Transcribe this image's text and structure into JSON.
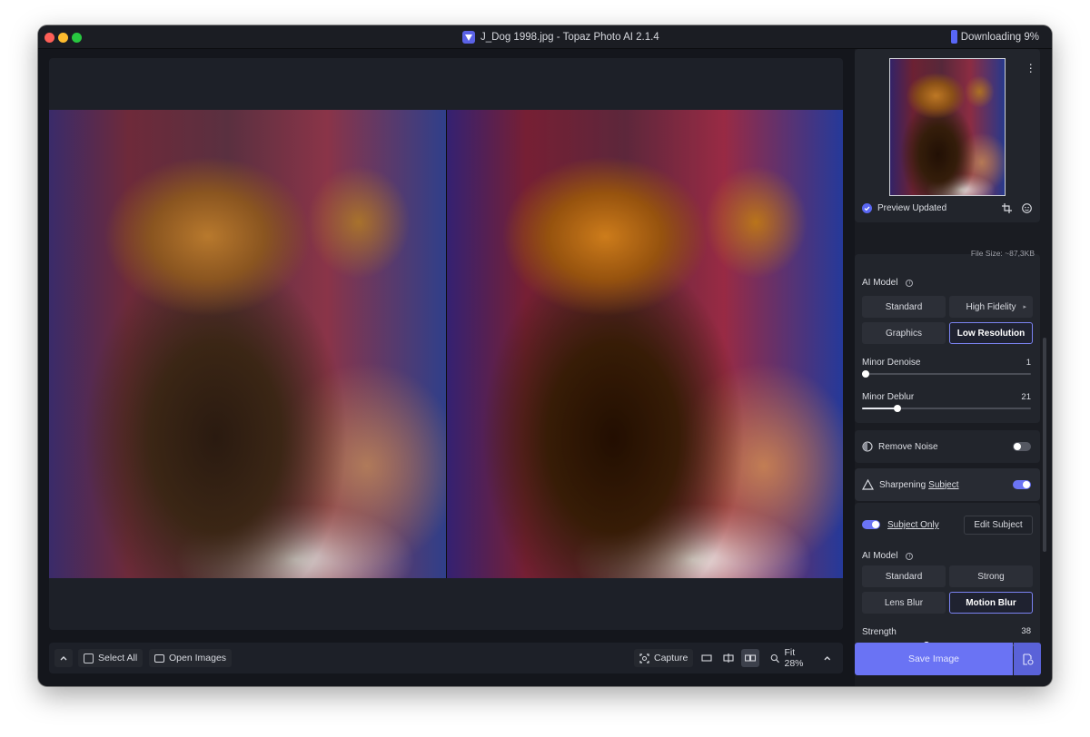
{
  "window": {
    "title": "J_Dog 1998.jpg - Topaz Photo AI 2.1.4",
    "download_status": "Downloading 9%"
  },
  "colors": {
    "accent": "#6a73f4",
    "toggle_on": "#6b74f5",
    "selected_border": "#7b83f2",
    "status_check": "#5a67f2"
  },
  "preview": {
    "status": "Preview Updated",
    "file_size": "File Size: ~87,3KB"
  },
  "enhance": {
    "ai_model_label": "AI Model",
    "models": [
      "Standard",
      "High Fidelity",
      "Graphics",
      "Low Resolution"
    ],
    "selected_model": "Low Resolution",
    "sliders": [
      {
        "label": "Minor Denoise",
        "value": "1",
        "fraction": 0.01
      },
      {
        "label": "Minor Deblur",
        "value": "21",
        "fraction": 0.21
      }
    ]
  },
  "remove_noise": {
    "label": "Remove Noise",
    "enabled": false
  },
  "sharpening": {
    "label": "Sharpening",
    "subject_link": "Subject",
    "enabled": true,
    "subject_only_label": "Subject Only",
    "subject_only_enabled": true,
    "edit_subject_label": "Edit Subject",
    "ai_model_label": "AI Model",
    "models": [
      "Standard",
      "Strong",
      "Lens Blur",
      "Motion Blur"
    ],
    "selected_model": "Motion Blur",
    "strength_label": "Strength",
    "strength_value": "38",
    "strength_fraction": 0.38
  },
  "bottombar": {
    "select_all": "Select All",
    "open_images": "Open Images",
    "capture": "Capture",
    "zoom": "Fit 28%"
  },
  "save": {
    "label": "Save Image"
  }
}
